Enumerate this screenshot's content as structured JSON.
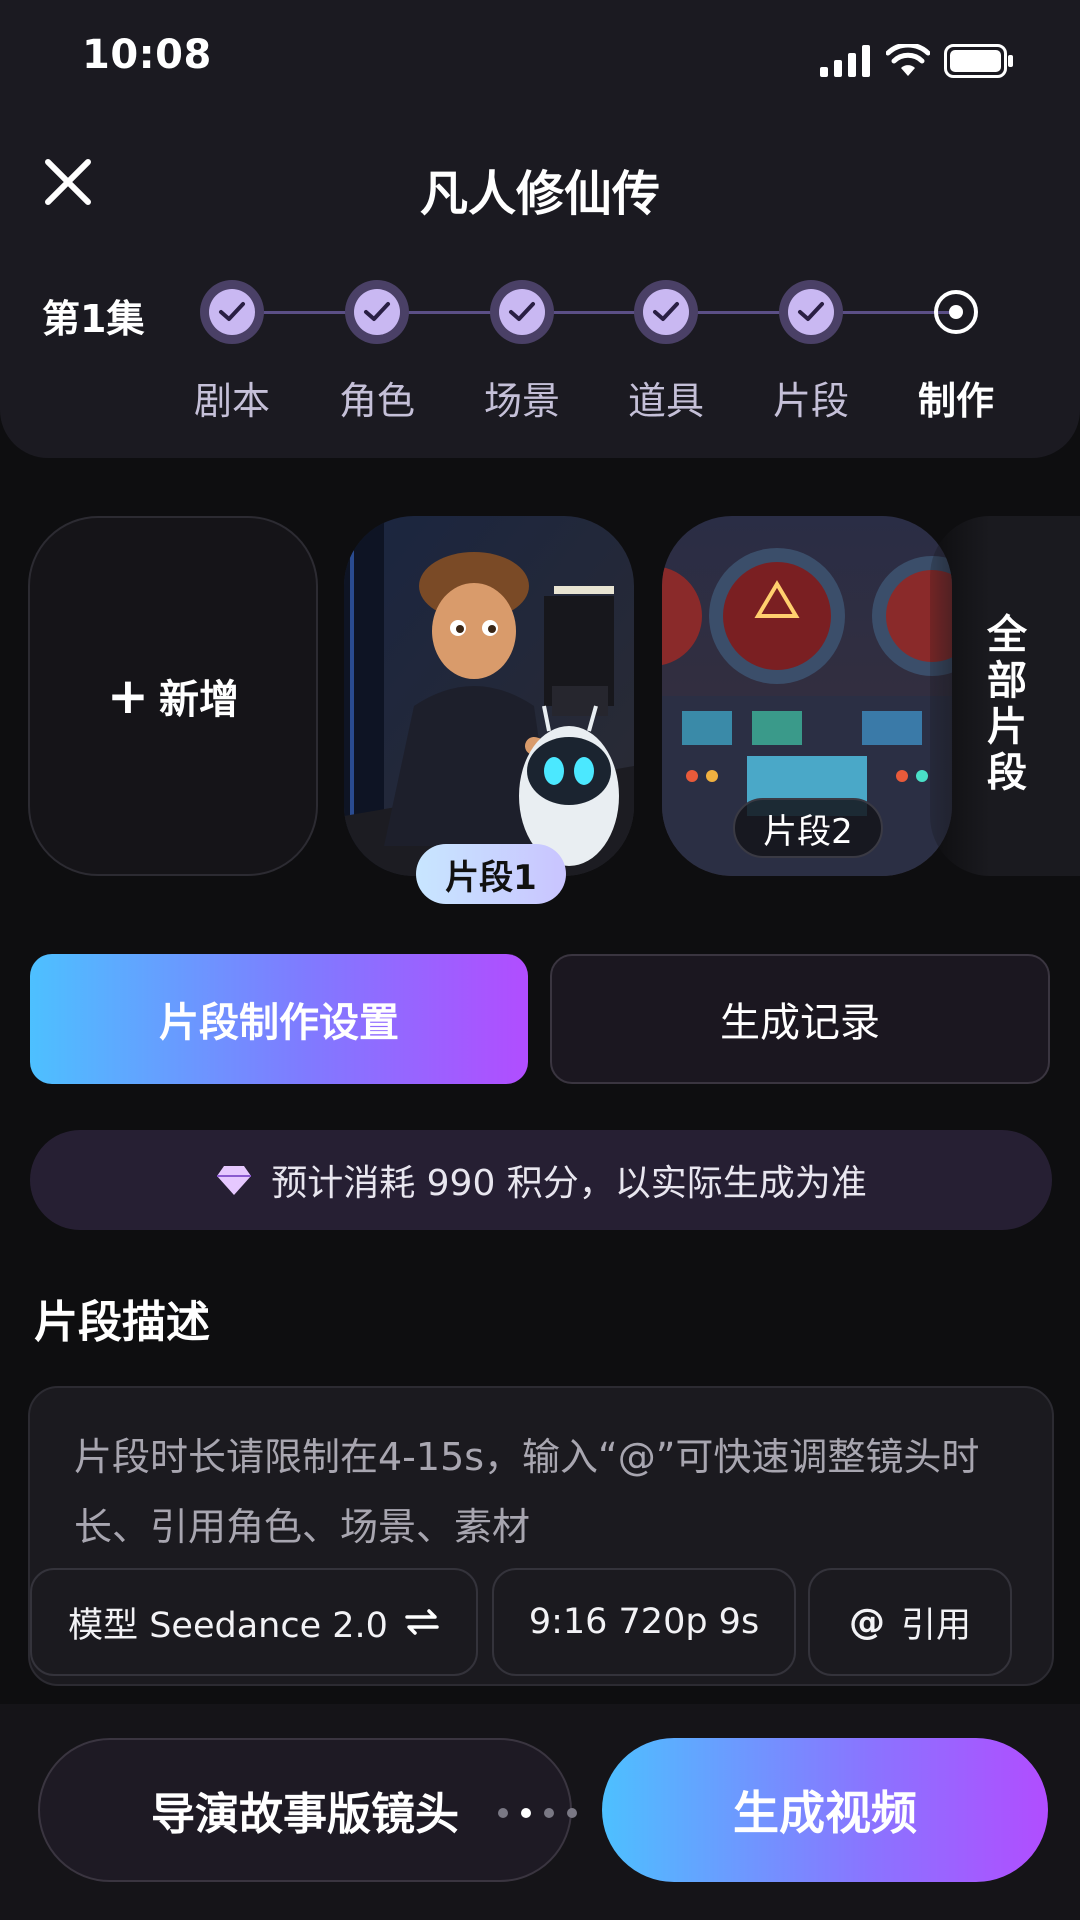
{
  "status_bar": {
    "time": "10:08"
  },
  "header": {
    "title": "凡人修仙传",
    "episode": "第1集"
  },
  "steps": [
    {
      "label": "剧本",
      "state": "done"
    },
    {
      "label": "角色",
      "state": "done"
    },
    {
      "label": "场景",
      "state": "done"
    },
    {
      "label": "道具",
      "state": "done"
    },
    {
      "label": "片段",
      "state": "done"
    },
    {
      "label": "制作",
      "state": "current"
    }
  ],
  "clips": {
    "add_label": "新增",
    "items": [
      {
        "label": "片段1",
        "selected": true
      },
      {
        "label": "片段2",
        "selected": false
      }
    ],
    "all_label": "全部片段"
  },
  "tabs": {
    "settings": "片段制作设置",
    "history": "生成记录"
  },
  "cost": {
    "text": "预计消耗 990 积分，以实际生成为准"
  },
  "description": {
    "title": "片段描述",
    "placeholder": "片段时长请限制在4-15s，输入“@”可快速调整镜头时长、引用角色、场景、素材"
  },
  "chips": {
    "model": "模型 Seedance 2.0",
    "spec": "9:16 720p 9s",
    "reference": "引用"
  },
  "bottom": {
    "director": "导演故事版镜头",
    "generate": "生成视频"
  },
  "colors": {
    "accent_start": "#4dc0ff",
    "accent_end": "#b14dff",
    "step_done": "#c9b8f2"
  }
}
